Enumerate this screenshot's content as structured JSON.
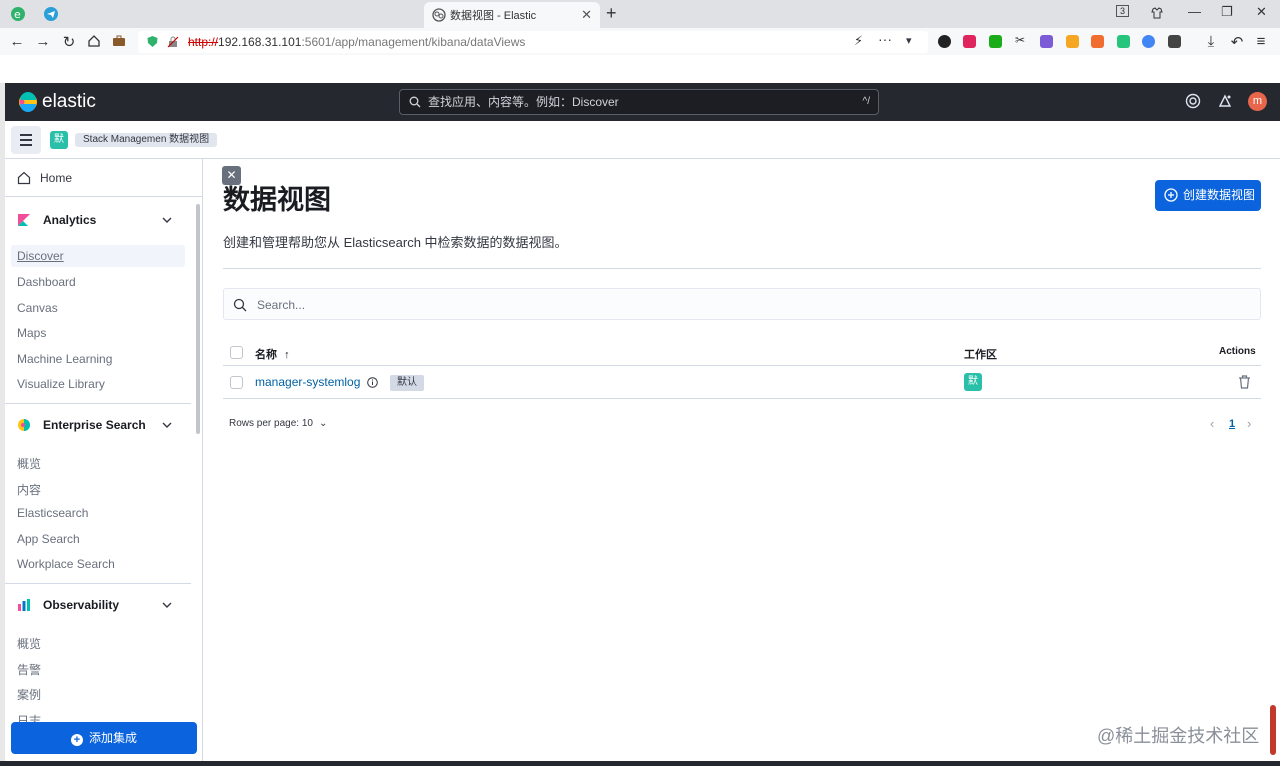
{
  "browser": {
    "tab_title": "数据视图 - Elastic",
    "new_tab": "+",
    "tab_close": "✕",
    "url_protocol": "http://",
    "url_host": "192.168.31.101",
    "url_path": ":5601/app/management/kibana/dataViews",
    "tab_count": "3"
  },
  "header": {
    "logo_text": "elastic",
    "search_placeholder": "查找应用、内容等。例如：Discover",
    "search_shortcut": "^/",
    "avatar_initial": "m"
  },
  "breadcrumb": {
    "space_badge": "默",
    "path": "Stack Managemen 数据视图"
  },
  "sidenav": {
    "home": "Home",
    "groups": [
      {
        "title": "Analytics",
        "items": [
          "Discover",
          "Dashboard",
          "Canvas",
          "Maps",
          "Machine Learning",
          "Visualize Library"
        ]
      },
      {
        "title": "Enterprise Search",
        "items": [
          "概览",
          "内容",
          "Elasticsearch",
          "App Search",
          "Workplace Search"
        ]
      },
      {
        "title": "Observability",
        "items": [
          "概览",
          "告警",
          "案例",
          "日志"
        ]
      }
    ],
    "add_integration": "添加集成"
  },
  "main": {
    "title": "数据视图",
    "subtitle": "创建和管理帮助您从 Elasticsearch 中检索数据的数据视图。",
    "create_button": "创建数据视图",
    "search_placeholder": "Search...",
    "columns": {
      "name": "名称",
      "sort_arrow": "↑",
      "workspace": "工作区",
      "actions": "Actions"
    },
    "rows": [
      {
        "name": "manager-systemlog",
        "tag": "默认",
        "space": "默"
      }
    ],
    "rows_per_page": "Rows per page: 10",
    "current_page": "1"
  },
  "watermark": "@稀土掘金技术社区",
  "colors": {
    "accent": "#0b64dd",
    "space": "#29bfa8",
    "header": "#25282f"
  }
}
